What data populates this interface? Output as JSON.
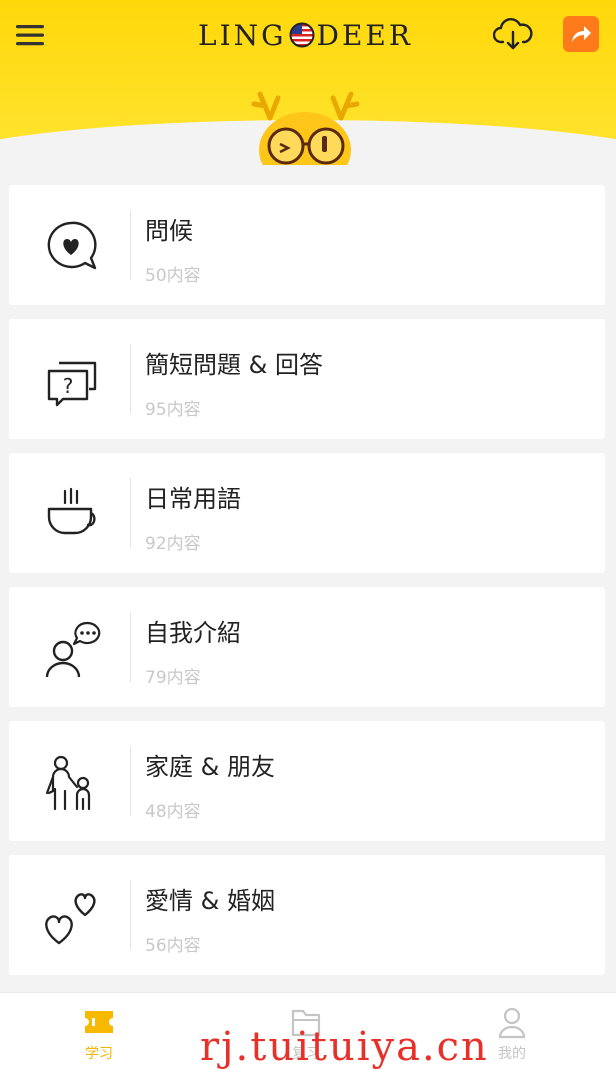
{
  "header": {
    "logo_left": "LING",
    "logo_right": "DEER",
    "accent_color": "#ffd80a",
    "share_color": "#ff7a1a"
  },
  "icons": {
    "menu": "hamburger-menu-icon",
    "flag": "us-flag-icon",
    "download": "cloud-download-icon",
    "share": "share-arrow-icon"
  },
  "categories": [
    {
      "title": "問候",
      "subtitle": "50内容",
      "icon": "speech-heart-icon"
    },
    {
      "title": "簡短問題 & 回答",
      "subtitle": "95内容",
      "icon": "question-chat-icon"
    },
    {
      "title": "日常用語",
      "subtitle": "92内容",
      "icon": "coffee-cup-icon"
    },
    {
      "title": "自我介紹",
      "subtitle": "79内容",
      "icon": "person-chat-icon"
    },
    {
      "title": "家庭 & 朋友",
      "subtitle": "48内容",
      "icon": "family-icon"
    },
    {
      "title": "愛情 & 婚姻",
      "subtitle": "56内容",
      "icon": "hearts-icon"
    }
  ],
  "tabs": [
    {
      "label": "学习",
      "active": true
    },
    {
      "label": "复习",
      "active": false
    },
    {
      "label": "我的",
      "active": false
    }
  ],
  "watermark": "rj.tuituiya.cn"
}
